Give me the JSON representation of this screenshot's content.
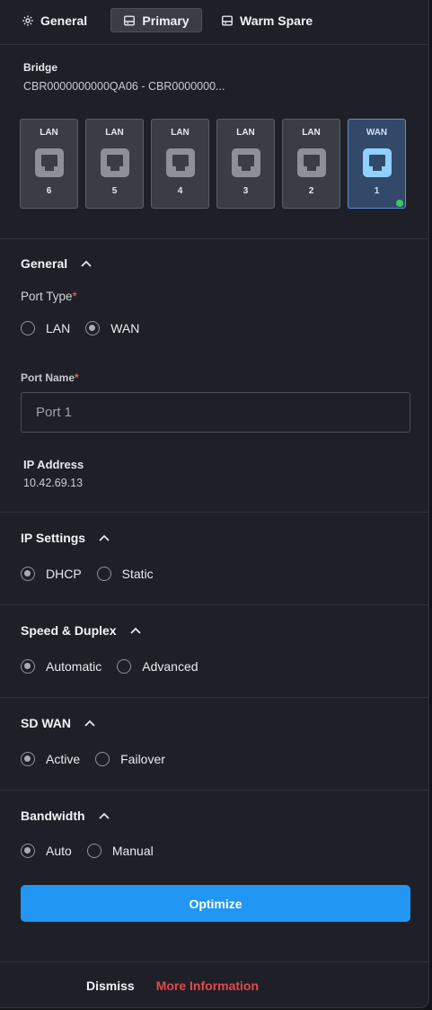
{
  "tabs": [
    {
      "label": "General",
      "icon": "gear-icon"
    },
    {
      "label": "Primary",
      "icon": "device-icon",
      "active": true
    },
    {
      "label": "Warm Spare",
      "icon": "device-icon"
    }
  ],
  "bridge": {
    "label": "Bridge",
    "value": "CBR0000000000QA06 - CBR0000000..."
  },
  "ports": [
    {
      "type": "LAN",
      "number": "6",
      "selected": false
    },
    {
      "type": "LAN",
      "number": "5",
      "selected": false
    },
    {
      "type": "LAN",
      "number": "4",
      "selected": false
    },
    {
      "type": "LAN",
      "number": "3",
      "selected": false
    },
    {
      "type": "LAN",
      "number": "2",
      "selected": false
    },
    {
      "type": "WAN",
      "number": "1",
      "selected": true,
      "status_color": "#3ec46d"
    }
  ],
  "general": {
    "title": "General",
    "port_type_label": "Port Type",
    "required_mark": "*",
    "port_type_options": [
      "LAN",
      "WAN"
    ],
    "port_type_selected": "WAN",
    "port_name_label": "Port Name",
    "port_name_value": "Port 1",
    "ip_address_label": "IP Address",
    "ip_address_value": "10.42.69.13"
  },
  "ip_settings": {
    "title": "IP Settings",
    "options": [
      "DHCP",
      "Static"
    ],
    "selected": "DHCP"
  },
  "speed_duplex": {
    "title": "Speed & Duplex",
    "options": [
      "Automatic",
      "Advanced"
    ],
    "selected": "Automatic"
  },
  "sd_wan": {
    "title": "SD WAN",
    "options": [
      "Active",
      "Failover"
    ],
    "selected": "Active"
  },
  "bandwidth": {
    "title": "Bandwidth",
    "options": [
      "Auto",
      "Manual"
    ],
    "selected": "Auto"
  },
  "actions": {
    "optimize": "Optimize",
    "dismiss": "Dismiss",
    "more_info": "More Information"
  },
  "colors": {
    "accent": "#2196f3",
    "link_danger": "#e5484d",
    "status_ok": "#3ec46d",
    "background": "#1f2027"
  }
}
